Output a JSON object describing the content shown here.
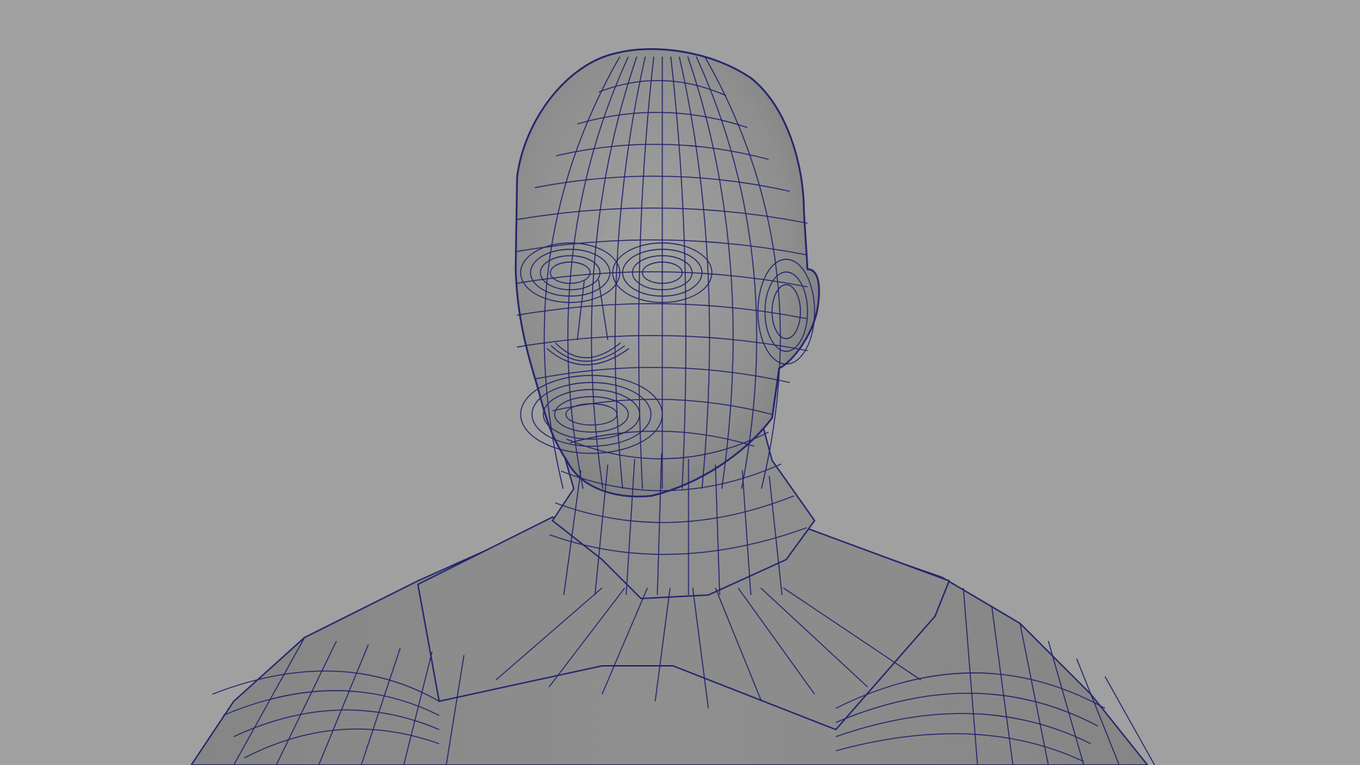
{
  "viewport": {
    "background": "#a0a0a0",
    "mesh_fill": "#8f8f8f",
    "mesh_fill_light": "#9a9a9a",
    "mesh_shadow": "#7a7a7a",
    "wire_color": "#24246e",
    "display_mode": "wireframe-on-shaded",
    "subject": "polygon-human-head-and-torso"
  }
}
